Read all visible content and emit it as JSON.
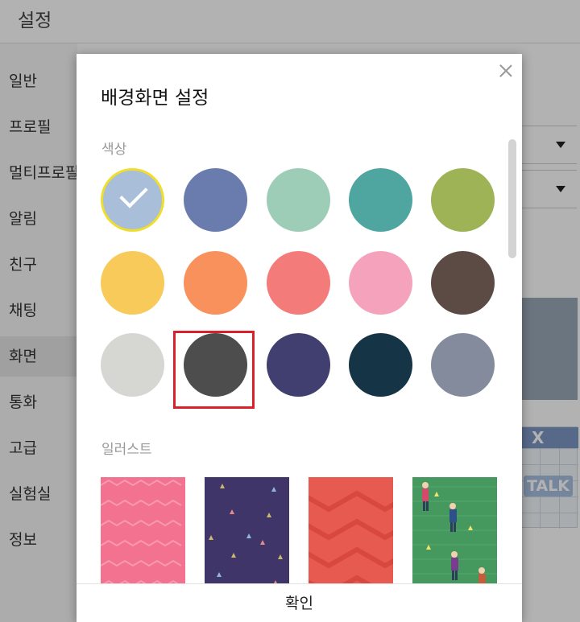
{
  "background": {
    "window_title": "설정",
    "sidebar": [
      {
        "label": "일반"
      },
      {
        "label": "프로필"
      },
      {
        "label": "멀티프로필"
      },
      {
        "label": "알림"
      },
      {
        "label": "친구"
      },
      {
        "label": "채팅"
      },
      {
        "label": "화면",
        "active": true
      },
      {
        "label": "통화"
      },
      {
        "label": "고급"
      },
      {
        "label": "실험실"
      },
      {
        "label": "정보"
      }
    ],
    "preview_letter": "X",
    "preview_text": "TALK"
  },
  "modal": {
    "title": "배경화면 설정",
    "color_section_label": "색상",
    "colors": [
      [
        "#a9bfd9",
        "#6a7bae",
        "#9ecdb7",
        "#4fa6a1",
        "#9db356"
      ],
      [
        "#f8ca5a",
        "#f9915d",
        "#f37c7b",
        "#f5a3bd",
        "#5c4b45"
      ],
      [
        "#d6d6d3",
        "#4d4d4d",
        "#413f70",
        "#153547",
        "#838b9d"
      ]
    ],
    "selected_color": "#a9bfd9",
    "highlighted_color": "#4d4d4d",
    "illust_section_label": "일러스트",
    "illustrations": [
      {
        "name": "pink-pattern",
        "color": "#f3728f"
      },
      {
        "name": "purple-confetti",
        "color": "#3f3568"
      },
      {
        "name": "coral-chevron",
        "color": "#e75a50"
      },
      {
        "name": "green-people",
        "color": "#46995e"
      }
    ],
    "confirm_label": "확인"
  }
}
